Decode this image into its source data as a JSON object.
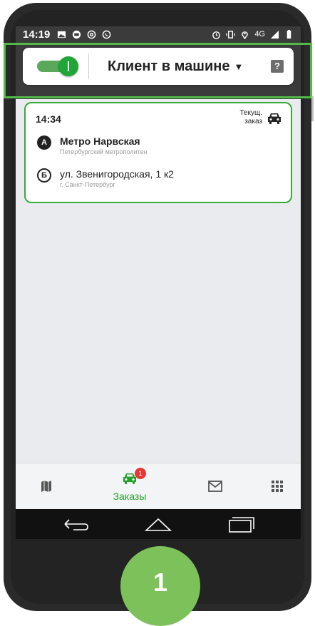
{
  "statusbar": {
    "time": "14:19",
    "network": "4G",
    "left_icons": [
      "image-icon",
      "taxi-icon",
      "at-icon",
      "whatsapp-icon"
    ],
    "right_icons": [
      "alarm-icon",
      "vibrate-icon",
      "location-icon",
      "signal-icon",
      "battery-icon"
    ]
  },
  "header": {
    "status_label": "Клиент в машине",
    "toggle_on": true,
    "help_glyph": "?"
  },
  "order": {
    "time": "14:34",
    "tag_line1": "Текущ.",
    "tag_line2": "заказ",
    "stops": [
      {
        "marker": "А",
        "title": "Метро Нарвская",
        "subtitle": "Петербургский метрополитен"
      },
      {
        "marker": "Б",
        "title": "ул. Звенигородская, 1 к2",
        "subtitle": "г. Санкт-Петербург"
      }
    ]
  },
  "bottom_nav": {
    "orders_label": "Заказы",
    "orders_badge": "1",
    "items": [
      "map-icon",
      "taxi-icon",
      "mail-icon",
      "apps-grid-icon"
    ]
  },
  "step": {
    "number": "1"
  },
  "colors": {
    "accent": "#27a12d",
    "highlight": "#52b847",
    "step": "#7cc15a",
    "statusbar": "#3b3b3b"
  }
}
